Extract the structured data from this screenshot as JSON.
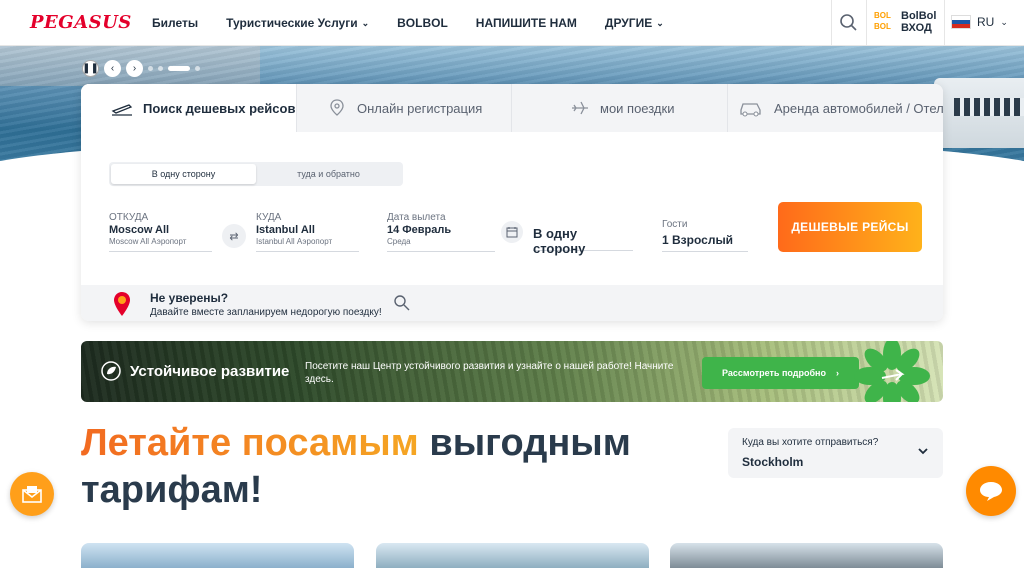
{
  "header": {
    "logo": "PEGASUS",
    "nav": [
      "Билеты",
      "Туристические Услуги",
      "BOLBOL",
      "НАПИШИТЕ НАМ",
      "ДРУГИЕ"
    ],
    "bolbol_logo_top": "BOL",
    "bolbol_logo_bottom": "BOL",
    "bolbol_label": "BolBol",
    "login_label": "ВХОД",
    "language": "RU"
  },
  "booking": {
    "tabs": [
      "Поиск дешевых рейсов",
      "Онлайн регистрация",
      "мои поездки",
      "Аренда автомобилей / Отели"
    ],
    "trip_types": [
      "В одну сторону",
      "туда и обратно"
    ],
    "from": {
      "label": "ОТКУДА",
      "value": "Moscow All",
      "sub": "Moscow All Аэропорт"
    },
    "to": {
      "label": "КУДА",
      "value": "Istanbul All",
      "sub": "Istanbul All Аэропорт"
    },
    "departure": {
      "label": "Дата вылета",
      "value": "14 Февраль",
      "sub": "Среда"
    },
    "return_value": "В одну сторону",
    "guests": {
      "label": "Гости",
      "value": "1 Взрослый"
    },
    "search_button": "ДЕШЕВЫЕ РЕЙСЫ",
    "unsure_title": "Не уверены?",
    "unsure_sub": "Давайте вместе запланируем недорогую поездку!"
  },
  "sustain": {
    "title": "Устойчивое развитие",
    "desc": "Посетите наш Центр устойчивого развития и узнайте о нашей работе! Начните здесь.",
    "button": "Рассмотреть подробно"
  },
  "headline": {
    "orange": "Летайте посамым",
    "dark1": "выгодным",
    "dark2": "тарифам!"
  },
  "destination": {
    "label": "Куда вы хотите отправиться?",
    "value": "Stockholm"
  },
  "colors": {
    "brand_red": "#e4002b",
    "accent_orange": "#ff8a00",
    "cta_green": "#3fb44a",
    "text_dark": "#1f2d3d"
  }
}
